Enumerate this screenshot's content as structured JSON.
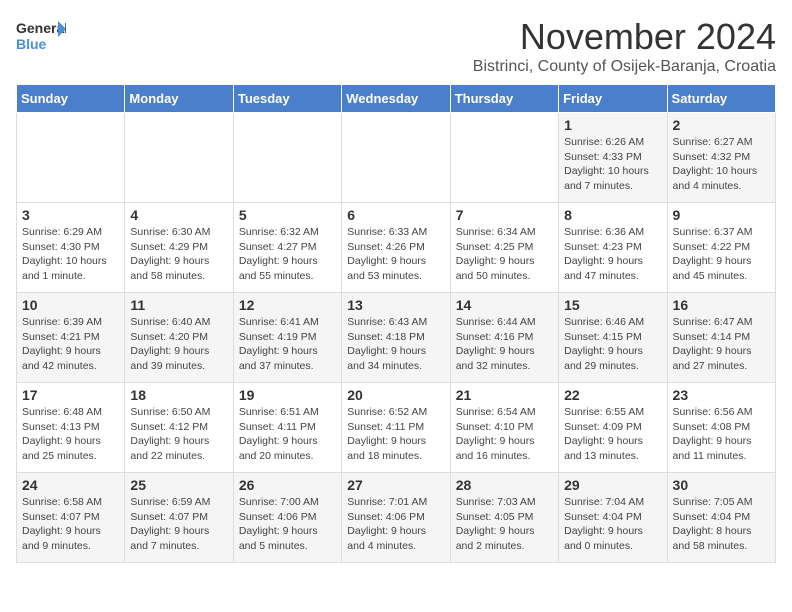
{
  "header": {
    "logo_general": "General",
    "logo_blue": "Blue",
    "month_title": "November 2024",
    "subtitle": "Bistrinci, County of Osijek-Baranja, Croatia"
  },
  "days_of_week": [
    "Sunday",
    "Monday",
    "Tuesday",
    "Wednesday",
    "Thursday",
    "Friday",
    "Saturday"
  ],
  "weeks": [
    [
      {
        "day": "",
        "info": ""
      },
      {
        "day": "",
        "info": ""
      },
      {
        "day": "",
        "info": ""
      },
      {
        "day": "",
        "info": ""
      },
      {
        "day": "",
        "info": ""
      },
      {
        "day": "1",
        "info": "Sunrise: 6:26 AM\nSunset: 4:33 PM\nDaylight: 10 hours and 7 minutes."
      },
      {
        "day": "2",
        "info": "Sunrise: 6:27 AM\nSunset: 4:32 PM\nDaylight: 10 hours and 4 minutes."
      }
    ],
    [
      {
        "day": "3",
        "info": "Sunrise: 6:29 AM\nSunset: 4:30 PM\nDaylight: 10 hours and 1 minute."
      },
      {
        "day": "4",
        "info": "Sunrise: 6:30 AM\nSunset: 4:29 PM\nDaylight: 9 hours and 58 minutes."
      },
      {
        "day": "5",
        "info": "Sunrise: 6:32 AM\nSunset: 4:27 PM\nDaylight: 9 hours and 55 minutes."
      },
      {
        "day": "6",
        "info": "Sunrise: 6:33 AM\nSunset: 4:26 PM\nDaylight: 9 hours and 53 minutes."
      },
      {
        "day": "7",
        "info": "Sunrise: 6:34 AM\nSunset: 4:25 PM\nDaylight: 9 hours and 50 minutes."
      },
      {
        "day": "8",
        "info": "Sunrise: 6:36 AM\nSunset: 4:23 PM\nDaylight: 9 hours and 47 minutes."
      },
      {
        "day": "9",
        "info": "Sunrise: 6:37 AM\nSunset: 4:22 PM\nDaylight: 9 hours and 45 minutes."
      }
    ],
    [
      {
        "day": "10",
        "info": "Sunrise: 6:39 AM\nSunset: 4:21 PM\nDaylight: 9 hours and 42 minutes."
      },
      {
        "day": "11",
        "info": "Sunrise: 6:40 AM\nSunset: 4:20 PM\nDaylight: 9 hours and 39 minutes."
      },
      {
        "day": "12",
        "info": "Sunrise: 6:41 AM\nSunset: 4:19 PM\nDaylight: 9 hours and 37 minutes."
      },
      {
        "day": "13",
        "info": "Sunrise: 6:43 AM\nSunset: 4:18 PM\nDaylight: 9 hours and 34 minutes."
      },
      {
        "day": "14",
        "info": "Sunrise: 6:44 AM\nSunset: 4:16 PM\nDaylight: 9 hours and 32 minutes."
      },
      {
        "day": "15",
        "info": "Sunrise: 6:46 AM\nSunset: 4:15 PM\nDaylight: 9 hours and 29 minutes."
      },
      {
        "day": "16",
        "info": "Sunrise: 6:47 AM\nSunset: 4:14 PM\nDaylight: 9 hours and 27 minutes."
      }
    ],
    [
      {
        "day": "17",
        "info": "Sunrise: 6:48 AM\nSunset: 4:13 PM\nDaylight: 9 hours and 25 minutes."
      },
      {
        "day": "18",
        "info": "Sunrise: 6:50 AM\nSunset: 4:12 PM\nDaylight: 9 hours and 22 minutes."
      },
      {
        "day": "19",
        "info": "Sunrise: 6:51 AM\nSunset: 4:11 PM\nDaylight: 9 hours and 20 minutes."
      },
      {
        "day": "20",
        "info": "Sunrise: 6:52 AM\nSunset: 4:11 PM\nDaylight: 9 hours and 18 minutes."
      },
      {
        "day": "21",
        "info": "Sunrise: 6:54 AM\nSunset: 4:10 PM\nDaylight: 9 hours and 16 minutes."
      },
      {
        "day": "22",
        "info": "Sunrise: 6:55 AM\nSunset: 4:09 PM\nDaylight: 9 hours and 13 minutes."
      },
      {
        "day": "23",
        "info": "Sunrise: 6:56 AM\nSunset: 4:08 PM\nDaylight: 9 hours and 11 minutes."
      }
    ],
    [
      {
        "day": "24",
        "info": "Sunrise: 6:58 AM\nSunset: 4:07 PM\nDaylight: 9 hours and 9 minutes."
      },
      {
        "day": "25",
        "info": "Sunrise: 6:59 AM\nSunset: 4:07 PM\nDaylight: 9 hours and 7 minutes."
      },
      {
        "day": "26",
        "info": "Sunrise: 7:00 AM\nSunset: 4:06 PM\nDaylight: 9 hours and 5 minutes."
      },
      {
        "day": "27",
        "info": "Sunrise: 7:01 AM\nSunset: 4:06 PM\nDaylight: 9 hours and 4 minutes."
      },
      {
        "day": "28",
        "info": "Sunrise: 7:03 AM\nSunset: 4:05 PM\nDaylight: 9 hours and 2 minutes."
      },
      {
        "day": "29",
        "info": "Sunrise: 7:04 AM\nSunset: 4:04 PM\nDaylight: 9 hours and 0 minutes."
      },
      {
        "day": "30",
        "info": "Sunrise: 7:05 AM\nSunset: 4:04 PM\nDaylight: 8 hours and 58 minutes."
      }
    ]
  ]
}
